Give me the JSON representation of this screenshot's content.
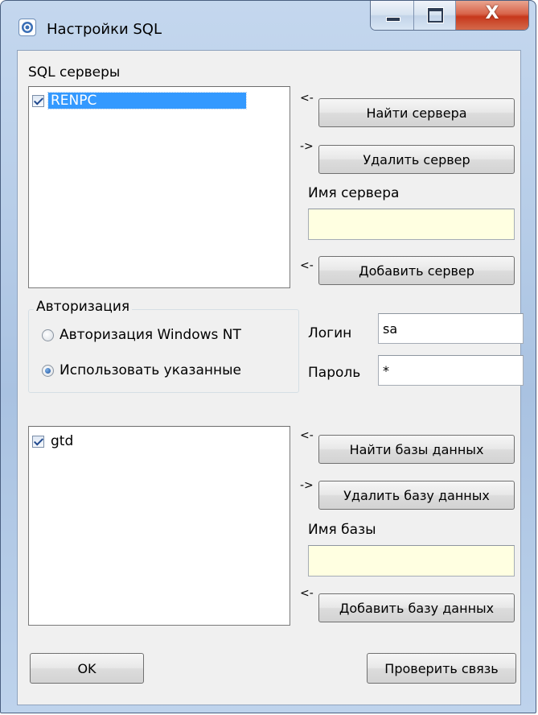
{
  "window": {
    "title": "Настройки SQL",
    "close_glyph": "X"
  },
  "servers": {
    "group_label": "SQL серверы",
    "items": [
      {
        "name": "RENPC",
        "checked": true,
        "selected": true
      }
    ],
    "find_button": "Найти сервера",
    "delete_button": "Удалить сервер",
    "name_label": "Имя сервера",
    "name_value": "",
    "add_button": "Добавить сервер",
    "arrow_find": "<-",
    "arrow_delete": "->",
    "arrow_add": "<-"
  },
  "auth": {
    "group_title": "Авторизация",
    "options": [
      {
        "label": "Авторизация Windows NT",
        "checked": false
      },
      {
        "label": "Использовать указанные",
        "checked": true
      }
    ],
    "login_label": "Логин",
    "login_value": "sa",
    "password_label": "Пароль",
    "password_value": "*"
  },
  "databases": {
    "items": [
      {
        "name": "gtd",
        "checked": true,
        "selected": false
      }
    ],
    "find_button": "Найти базы данных",
    "delete_button": "Удалить базу данных",
    "name_label": "Имя базы",
    "name_value": "",
    "add_button": "Добавить базу данных",
    "arrow_find": "<-",
    "arrow_delete": "->",
    "arrow_add": "<-"
  },
  "footer": {
    "ok_button": "OK",
    "test_button": "Проверить связь"
  },
  "colors": {
    "selection": "#3399ff",
    "input_highlight": "#ffffe1",
    "close_button": "#c7381c"
  },
  "icons": {
    "title_icon": "gear-database-icon",
    "minimize": "minimize-icon",
    "maximize": "maximize-icon",
    "close": "close-icon"
  }
}
